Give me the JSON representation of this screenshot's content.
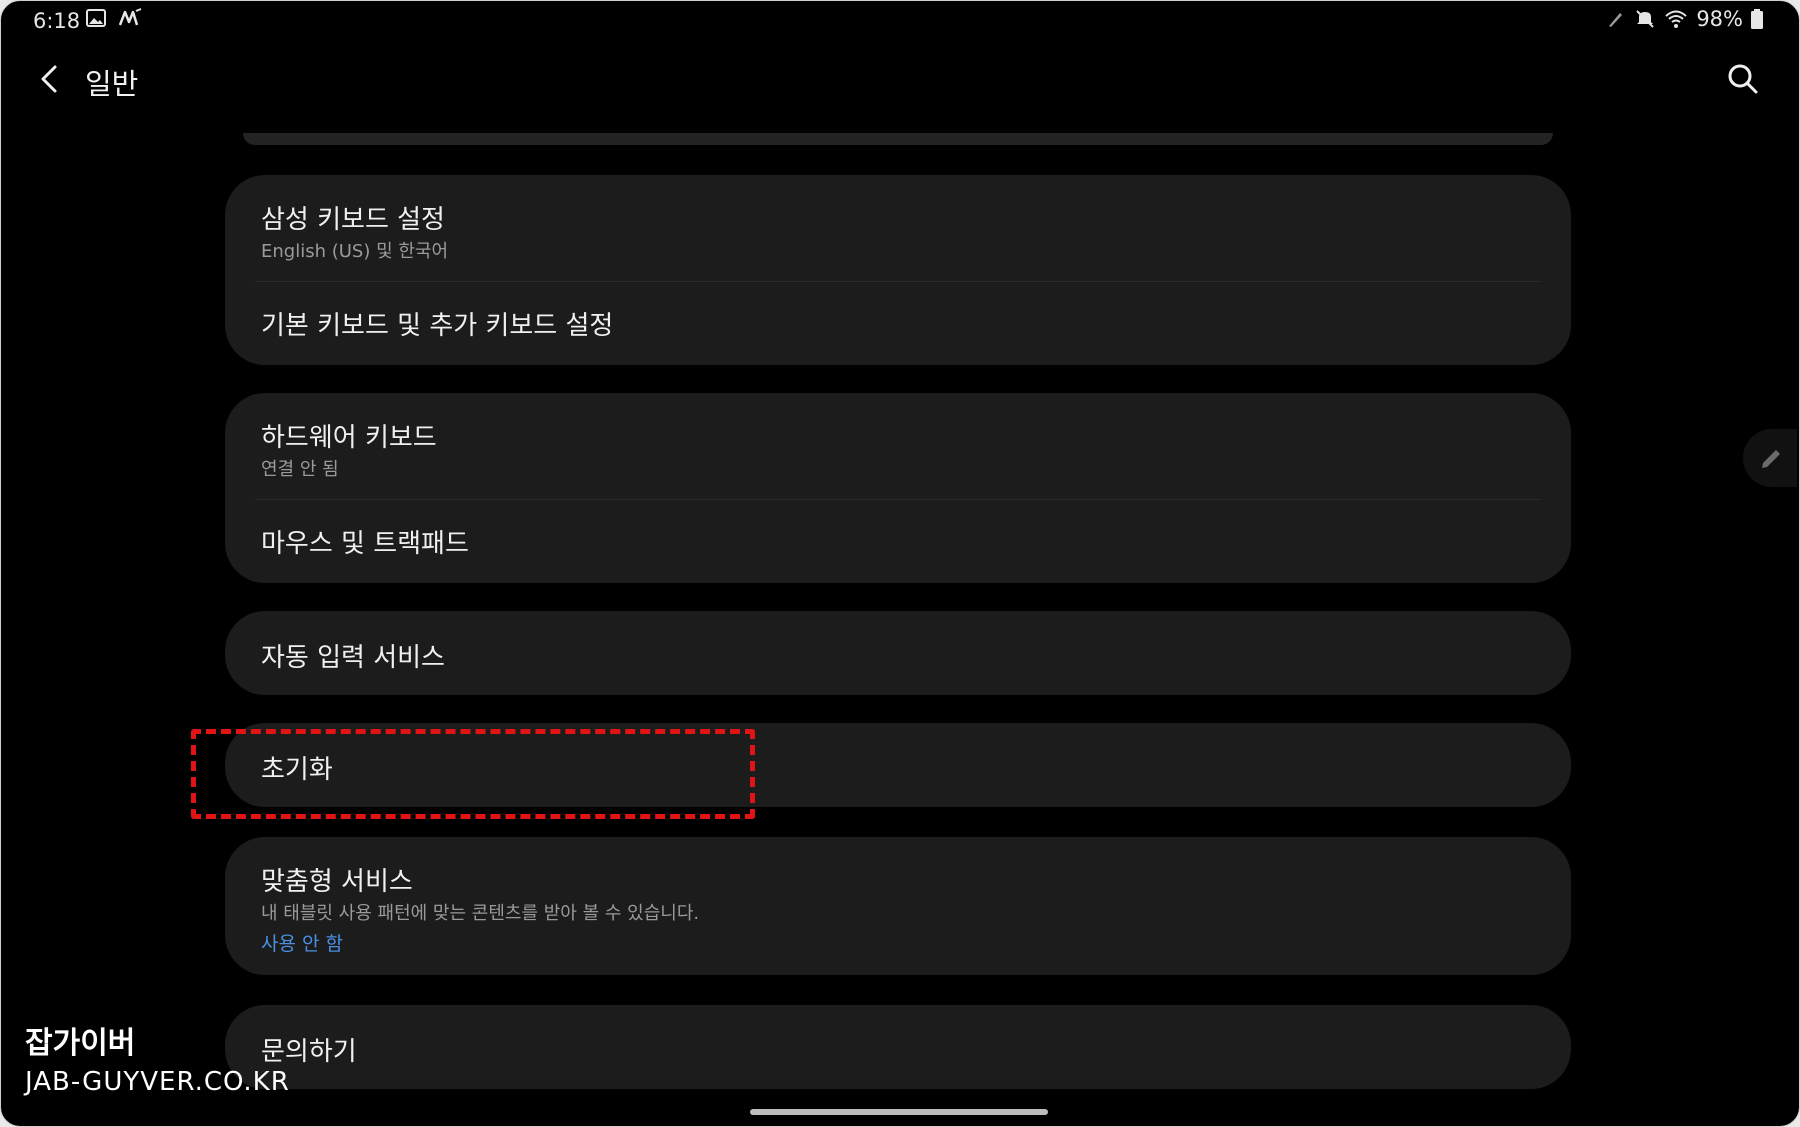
{
  "status": {
    "time": "6:18",
    "left_icons": [
      "gallery-icon",
      "handwriting-icon"
    ],
    "right_icons": [
      "pen-icon",
      "mute-icon",
      "wifi-icon"
    ],
    "battery": "98%"
  },
  "appbar": {
    "title": "일반",
    "back_icon": "chevron-left-icon",
    "search_icon": "search-icon"
  },
  "cards": {
    "keyboard": {
      "samsung_title": "삼성 키보드 설정",
      "samsung_sub": "English (US) 및 한국어",
      "default_title": "기본 키보드 및 추가 키보드 설정"
    },
    "hardware": {
      "hw_title": "하드웨어 키보드",
      "hw_sub": "연결 안 됨",
      "mouse_title": "마우스 및 트랙패드"
    },
    "autofill": {
      "title": "자동 입력 서비스"
    },
    "reset": {
      "title": "초기화"
    },
    "custom": {
      "title": "맞춤형 서비스",
      "sub": "내 태블릿 사용 패턴에 맞는 콘텐츠를 받아 볼 수 있습니다.",
      "status": "사용 안 함"
    },
    "contact": {
      "title": "문의하기"
    }
  },
  "watermark": {
    "line1": "잡가이버",
    "line2": "JAB-GUYVER.CO.KR"
  },
  "colors": {
    "background": "#000000",
    "card": "#1c1c1c",
    "accent": "#4a8fe0",
    "highlight": "#e01414"
  }
}
